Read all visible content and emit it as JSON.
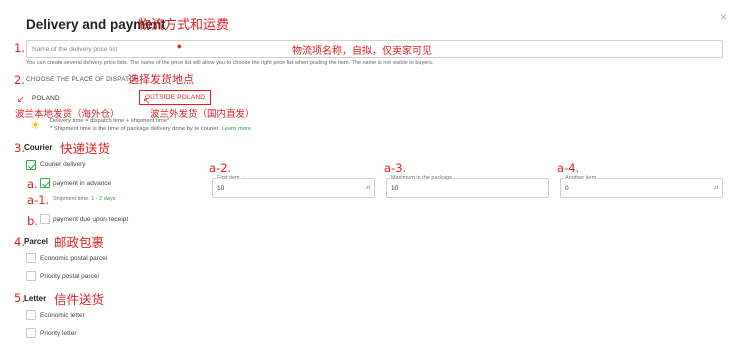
{
  "header": {
    "title": "Delivery and payment",
    "title_note": "物流方式和运费",
    "close_symbol": "×"
  },
  "step_numbers": {
    "n1": "1.",
    "n2": "2.",
    "n3": "3.",
    "n4": "4.",
    "n5": "5."
  },
  "price_list": {
    "placeholder": "Name of the delivery price list",
    "note": "物流项名称，自拟，仅卖家可见",
    "help": "You can create several delivery price lists. The name of the price list will allow you to choose the right price list when posting the item. The name is not visible to buyers."
  },
  "dispatch": {
    "label": "CHOOSE THE PLACE OF DISPATCH",
    "note": "选择发货地点",
    "tabs": [
      {
        "label": "POLAND",
        "note": "波兰本地发货（海外仓）",
        "selected": false
      },
      {
        "label": "OUTSIDE POLAND",
        "note": "波兰外发货（国内直发）",
        "selected": true
      }
    ],
    "info_line1": "Delivery time = dispatch time + shipment time*",
    "info_line2": "* Shipment time is the time of package delivery done by te courier.",
    "learn_more": "Learn more"
  },
  "courier": {
    "title": "Courier",
    "note": "快递送货",
    "delivery": {
      "label": "Courier delivery",
      "checked": true
    },
    "advance": {
      "marker": "a.",
      "label": "payment in advance",
      "checked": true
    },
    "shipment": {
      "marker": "a-1.",
      "label": "Shipment time:",
      "days": "1 - 2 days"
    },
    "upon_receipt": {
      "marker": "b.",
      "label": "payment due upon receipt",
      "checked": false
    },
    "fields": [
      {
        "marker": "a-2.",
        "label": "First item",
        "value": "10",
        "unit": "zł"
      },
      {
        "marker": "a-3.",
        "label": "Maximum in the package",
        "value": "10",
        "unit": ""
      },
      {
        "marker": "a-4.",
        "label": "Another item",
        "value": "0",
        "unit": "zł"
      }
    ]
  },
  "parcel": {
    "title": "Parcel",
    "note": "邮政包裹",
    "options": [
      {
        "label": "Economic postal parcel",
        "checked": false
      },
      {
        "label": "Priority postal parcel",
        "checked": false
      }
    ]
  },
  "letter": {
    "title": "Letter",
    "note": "信件送货",
    "options": [
      {
        "label": "Economic letter",
        "checked": false
      },
      {
        "label": "Priority letter",
        "checked": false
      }
    ]
  },
  "colors": {
    "annotation": "#e02020",
    "accent_green": "#3aa757",
    "link_green": "#2b9c4a"
  }
}
